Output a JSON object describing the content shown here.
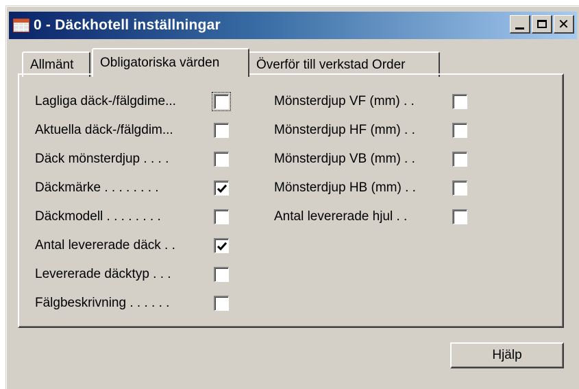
{
  "window": {
    "title": "0 - Däckhotell inställningar",
    "icon": "table-icon",
    "controls": {
      "minimize": "minimize-icon",
      "maximize": "maximize-icon",
      "close": "✕"
    }
  },
  "tabs": [
    {
      "label": "Allmänt",
      "active": false
    },
    {
      "label": "Obligatoriska värden",
      "active": true
    },
    {
      "label": "Överför till verkstad Order",
      "active": false
    }
  ],
  "left_fields": [
    {
      "label": "Lagliga däck-/fälgdime...",
      "checked": false,
      "focused": true
    },
    {
      "label": "Aktuella däck-/fälgdim...",
      "checked": false,
      "focused": false
    },
    {
      "label": "Däck mönsterdjup . . . .",
      "checked": false,
      "focused": false
    },
    {
      "label": "Däckmärke . . . . . . . .",
      "checked": true,
      "focused": false
    },
    {
      "label": "Däckmodell . . . . . . . .",
      "checked": false,
      "focused": false
    },
    {
      "label": "Antal levererade däck . .",
      "checked": true,
      "focused": false
    },
    {
      "label": "Levererade däcktyp . . .",
      "checked": false,
      "focused": false
    },
    {
      "label": "Fälgbeskrivning . . . . . .",
      "checked": false,
      "focused": false
    }
  ],
  "right_fields": [
    {
      "label": "Mönsterdjup VF (mm)  . .",
      "checked": false
    },
    {
      "label": "Mönsterdjup HF (mm)  . .",
      "checked": false
    },
    {
      "label": "Mönsterdjup VB (mm)  . .",
      "checked": false
    },
    {
      "label": "Mönsterdjup HB (mm)  . .",
      "checked": false
    },
    {
      "label": "Antal levererade hjul  . .",
      "checked": false
    }
  ],
  "help_button": "Hjälp"
}
